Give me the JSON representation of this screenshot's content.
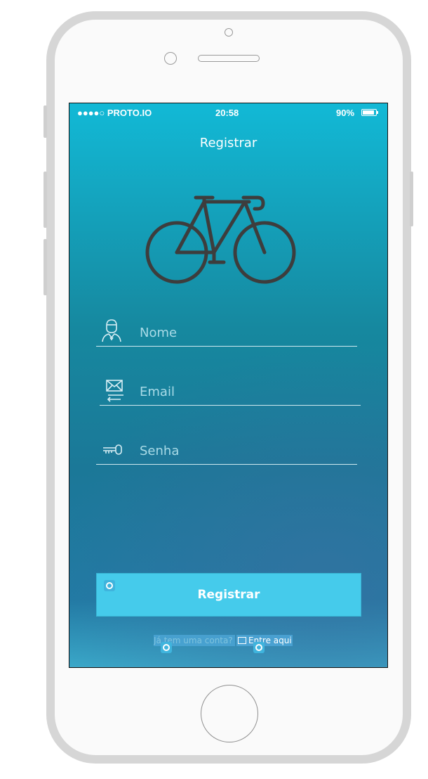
{
  "status_bar": {
    "carrier": "●●●●○ PROTO.IO",
    "time": "20:58",
    "battery": "90%"
  },
  "nav": {
    "title": "Registrar"
  },
  "logo": {
    "icon": "bicycle-icon"
  },
  "form": {
    "fields": [
      {
        "icon": "user-icon",
        "label": "Nome"
      },
      {
        "icon": "email-icon",
        "label": "Email"
      },
      {
        "icon": "key-icon",
        "label": "Senha"
      }
    ],
    "submit_label": "Registrar"
  },
  "footer": {
    "question": "Já tem uma conta?",
    "link": "Entre aqui"
  },
  "colors": {
    "button": "#45cbeb",
    "screen_top": "#12b9d6",
    "screen_mid": "#16889f",
    "bike": "#3d3d3d"
  }
}
